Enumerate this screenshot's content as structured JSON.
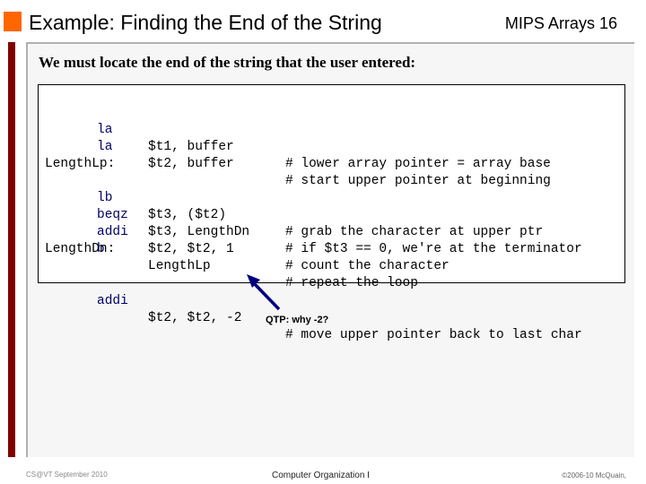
{
  "header": {
    "title": "Example: Finding the End of the String",
    "topic": "MIPS Arrays",
    "slide_number": "16",
    "accent_color": "#ff6600",
    "sidebar_color": "#800000"
  },
  "main": {
    "intro": "We must locate the end of the string that the user entered:",
    "code_lines": [
      {
        "label": "",
        "op": "la",
        "args": "$t1, buffer",
        "comment": "# lower array pointer = array base"
      },
      {
        "label": "",
        "op": "la",
        "args": "$t2, buffer",
        "comment": "# start upper pointer at beginning"
      },
      {
        "label": "LengthLp:",
        "op": "",
        "args": "",
        "comment": ""
      },
      {
        "label": "",
        "op": "lb",
        "args": "$t3, ($t2)",
        "comment": "# grab the character at upper ptr"
      },
      {
        "label": "",
        "op": "beqz",
        "args": "$t3, LengthDn",
        "comment": "# if $t3 == 0, we're at the terminator"
      },
      {
        "label": "",
        "op": "addi",
        "args": "$t2, $t2, 1",
        "comment": "# count the character"
      },
      {
        "label": "",
        "op": "b",
        "args": "LengthLp",
        "comment": "# repeat the loop"
      },
      {
        "label": "LengthDn:",
        "op": "",
        "args": "",
        "comment": ""
      },
      {
        "label": "",
        "op": "addi",
        "args": "$t2, $t2, -2",
        "comment": "# move upper pointer back to last char"
      }
    ],
    "annotation": "QTP:  why -2?"
  },
  "footer": {
    "left": "CS@VT September 2010",
    "center": "Computer Organization I",
    "right": "©2006-10  McQuain,"
  }
}
